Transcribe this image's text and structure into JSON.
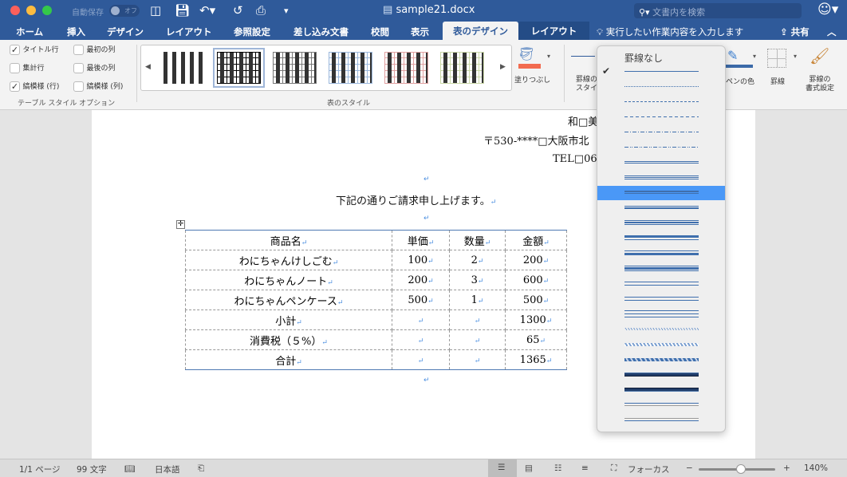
{
  "window": {
    "title": "sample21.docx",
    "autosave_label": "自動保存",
    "autosave_state": "オフ",
    "search_placeholder": "文書内を検索"
  },
  "tabs": [
    "ホーム",
    "挿入",
    "デザイン",
    "レイアウト",
    "参照設定",
    "差し込み文書",
    "校閲",
    "表示",
    "表のデザイン",
    "レイアウト"
  ],
  "active_tab": "表のデザイン",
  "tell_me": "実行したい作業内容を入力します",
  "share": "共有",
  "ribbon": {
    "options": [
      {
        "label": "タイトル行",
        "checked": true
      },
      {
        "label": "最初の列",
        "checked": false
      },
      {
        "label": "集計行",
        "checked": false
      },
      {
        "label": "最後の列",
        "checked": false
      },
      {
        "label": "縞模様 (行)",
        "checked": true
      },
      {
        "label": "縞模様 (列)",
        "checked": false
      }
    ],
    "options_group": "テーブル スタイル オプション",
    "styles_group": "表のスタイル",
    "shading": "塗りつぶし",
    "border_style": "罫線の\nスタイル",
    "border_style_l1": "罫線の",
    "border_style_l2": "スタイル",
    "pen_color": "ペンの色",
    "borders": "罫線",
    "border_painter_l1": "罫線の",
    "border_painter_l2": "書式設定",
    "shading_color": "#f26b4f"
  },
  "document": {
    "lines": [
      "和□美",
      "〒530-****□大阪市北",
      "TEL□06"
    ],
    "greeting": "下記の通りご請求申し上げます。",
    "table": {
      "headers": [
        "商品名",
        "単価",
        "数量",
        "金額"
      ],
      "rows": [
        [
          "わにちゃんけしごむ",
          "100",
          "2",
          "200"
        ],
        [
          "わにちゃんノート",
          "200",
          "3",
          "600"
        ],
        [
          "わにちゃんペンケース",
          "500",
          "1",
          "500"
        ],
        [
          "小計",
          "",
          "",
          "1300"
        ],
        [
          "消費税（５%）",
          "",
          "",
          "65"
        ],
        [
          "合計",
          "",
          "",
          "1365"
        ]
      ]
    }
  },
  "border_menu": {
    "none_label": "罫線なし",
    "checked_index": 0,
    "selected_index": 8,
    "styles": [
      "single",
      "dotted",
      "dashed-small",
      "dashed",
      "dash-dot",
      "dash-dot-dot",
      "double",
      "triple",
      "thick-thin-small",
      "thin-thick-small",
      "thin-thick-thin-small",
      "thick-thin-medium",
      "thin-thick-medium",
      "thin-thick-thin-medium",
      "thick-thin-large",
      "thin-thick-large",
      "thin-thick-thin-large",
      "wave",
      "double-wave",
      "dash-dot-stroked",
      "emboss-3d",
      "engrave-3d",
      "outset",
      "inset"
    ]
  },
  "status": {
    "page": "1/1 ページ",
    "words": "99 文字",
    "language": "日本語",
    "focus": "フォーカス",
    "zoom": "140%",
    "zoom_fraction": 0.55
  }
}
